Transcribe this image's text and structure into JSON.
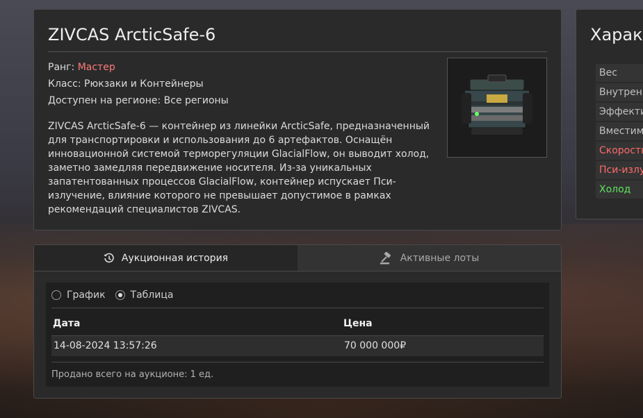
{
  "item": {
    "title": "ZIVCAS ArcticSafe-6",
    "rank_label": "Ранг:",
    "rank_value": "Мастер",
    "class_line": "Класс: Рюкзаки и Контейнеры",
    "region_line": "Доступен на регионе: Все регионы",
    "description": "ZIVCAS ArcticSafe-6 — контейнер из линейки ArcticSafe, предназначенный для транспортировки и использования до 6 артефактов. Оснащён инновационной системой терморегуляции GlacialFlow, он выводит холод, заметно замедляя передвижение носителя. Из-за уникальных запатентованных процессов GlacialFlow, контейнер испускает Пси-излучение, влияние которого не превышает допустимое в рамках рекомендаций специалистов ZIVCAS.",
    "image_icon": "container-case-icon"
  },
  "stats": {
    "title": "Характ",
    "rows": [
      {
        "label": "Вес",
        "tone": "neutral"
      },
      {
        "label": "Внутрен",
        "tone": "neutral"
      },
      {
        "label": "Эффекти",
        "tone": "neutral"
      },
      {
        "label": "Вместим",
        "tone": "neutral"
      },
      {
        "label": "Скорость",
        "tone": "negative"
      },
      {
        "label": "Пси-излу",
        "tone": "negative"
      },
      {
        "label": "Холод",
        "tone": "positive"
      }
    ]
  },
  "auction": {
    "tabs": [
      {
        "label": "Аукционная история",
        "icon": "history-icon",
        "active": true
      },
      {
        "label": "Активные лоты",
        "icon": "gavel-icon",
        "active": false
      }
    ],
    "view_options": [
      {
        "label": "График",
        "selected": false
      },
      {
        "label": "Таблица",
        "selected": true
      }
    ],
    "table": {
      "headers": [
        "Дата",
        "Цена"
      ],
      "rows": [
        [
          "14-08-2024 13:57:26",
          "70 000 000₽"
        ]
      ]
    },
    "sold_total": "Продано всего на аукционе: 1 ед."
  },
  "colors": {
    "panel_bg": "#2a2a2a",
    "rank_color": "#ff7b7b",
    "negative_stat": "#ff6a6a",
    "positive_stat": "#5fe35f"
  }
}
